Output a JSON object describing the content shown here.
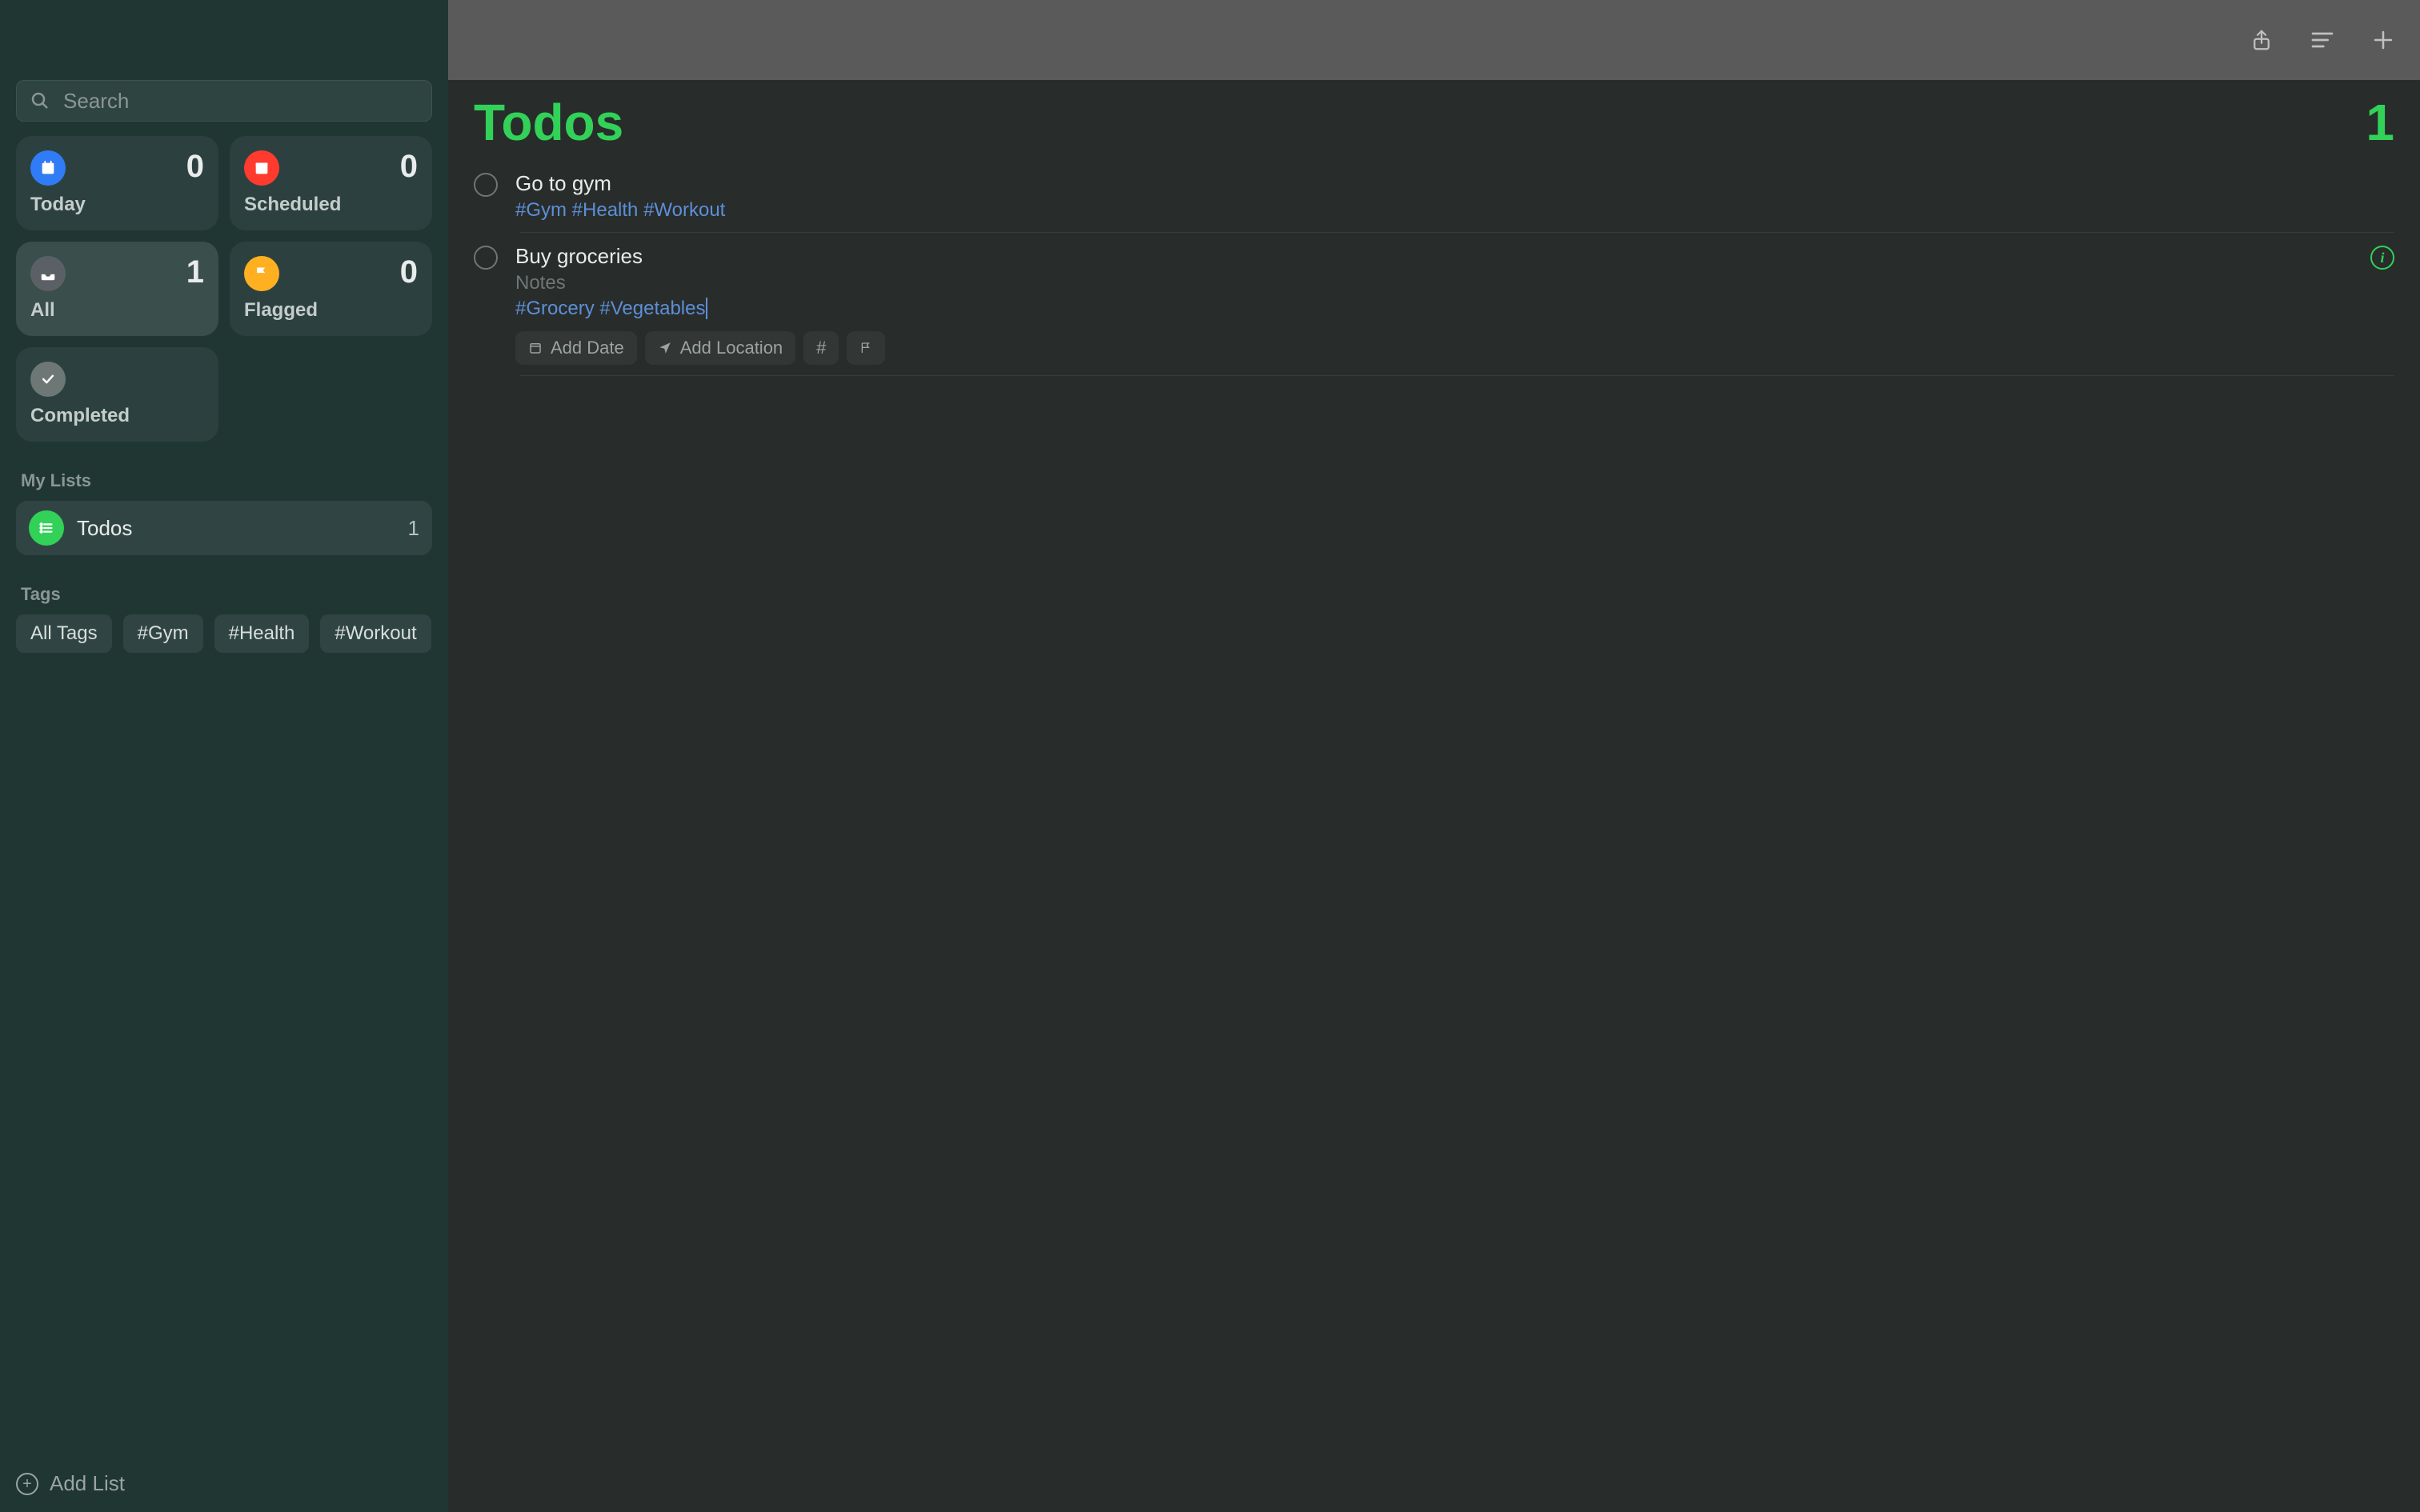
{
  "accent": "#32d158",
  "sidebar": {
    "search_placeholder": "Search",
    "smart": {
      "today": {
        "label": "Today",
        "count": "0"
      },
      "scheduled": {
        "label": "Scheduled",
        "count": "0"
      },
      "all": {
        "label": "All",
        "count": "1"
      },
      "flagged": {
        "label": "Flagged",
        "count": "0"
      },
      "completed": {
        "label": "Completed"
      }
    },
    "section_lists": "My Lists",
    "lists": [
      {
        "name": "Todos",
        "count": "1"
      }
    ],
    "section_tags": "Tags",
    "tags": [
      "All Tags",
      "#Gym",
      "#Health",
      "#Workout"
    ],
    "add_list": "Add List"
  },
  "main": {
    "title": "Todos",
    "count": "1",
    "reminders": [
      {
        "title": "Go to gym",
        "tags": "#Gym #Health #Workout"
      },
      {
        "title": "Buy groceries",
        "notes_placeholder": "Notes",
        "tags": "#Grocery #Vegetables",
        "editing": true,
        "actions": {
          "add_date": "Add Date",
          "add_location": "Add Location",
          "hash": "#",
          "flag": ""
        }
      }
    ]
  }
}
